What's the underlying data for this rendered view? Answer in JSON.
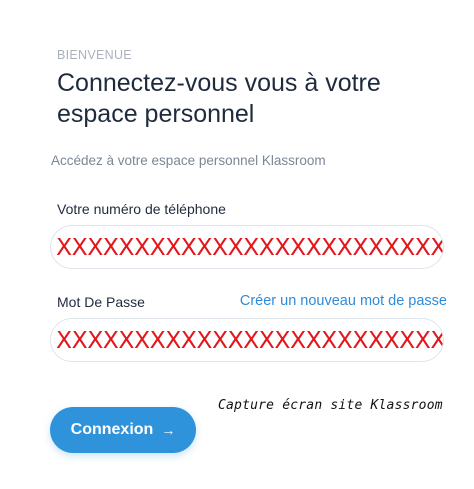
{
  "header": {
    "eyebrow": "BIENVENUE",
    "title": "Connectez-vous vous à votre espace personnel",
    "subtitle": "Accédez à votre espace personnel Klassroom"
  },
  "form": {
    "phone": {
      "label": "Votre numéro de téléphone",
      "value": "XXXXXXXXXXXXXXXXXXXXXXXXXXX"
    },
    "password": {
      "label": "Mot De Passe",
      "value": "XXXXXXXXXXXXXXXXXXXXXXXXXXX",
      "reset_link": "Créer un nouveau mot de passe"
    },
    "submit": {
      "label": "Connexion",
      "arrow": "→"
    }
  },
  "caption": "Capture écran site Klassroom",
  "colors": {
    "accent": "#2f93dc",
    "link": "#2f8bd8",
    "redaction": "#e3161b"
  }
}
